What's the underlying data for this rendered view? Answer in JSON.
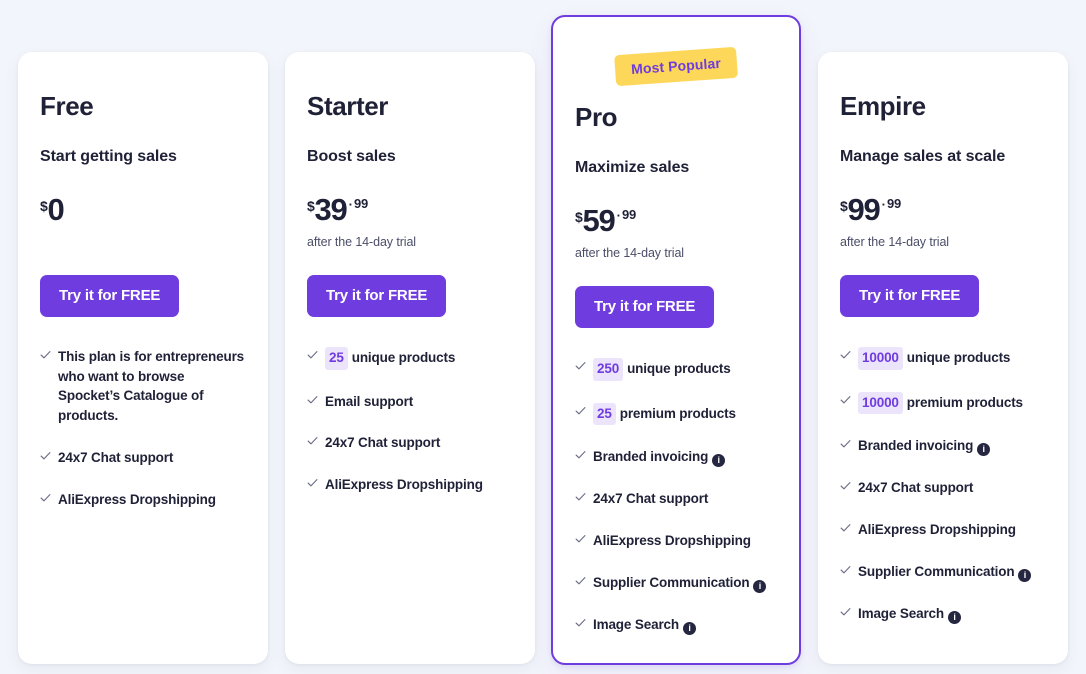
{
  "theme": {
    "page_background": "#f3f5fc",
    "accent_purple": "#6f3ce0",
    "badge_yellow": "#fcd75a",
    "count_badge_bg": "#ece4fb",
    "info_icon_bg": "#252741",
    "text_dark": "#1f2137"
  },
  "plans": [
    {
      "name": "Free",
      "tagline": "Start getting sales",
      "price": {
        "currency": "$",
        "whole": "0",
        "separator": "",
        "cents": ""
      },
      "trial_note": "",
      "cta_label": "Try it for FREE",
      "popular_badge": "",
      "features": [
        {
          "badge": "",
          "text": "This plan is for entrepreneurs who want to browse Spocket’s Catalogue of products.",
          "info": false
        },
        {
          "badge": "",
          "text": "24x7 Chat support",
          "info": false
        },
        {
          "badge": "",
          "text": "AliExpress Dropshipping",
          "info": false
        }
      ]
    },
    {
      "name": "Starter",
      "tagline": "Boost sales",
      "price": {
        "currency": "$",
        "whole": "39",
        "separator": "·",
        "cents": "99"
      },
      "trial_note": "after the 14-day trial",
      "cta_label": "Try it for FREE",
      "popular_badge": "",
      "features": [
        {
          "badge": "25",
          "text": "unique products",
          "info": false
        },
        {
          "badge": "",
          "text": "Email support",
          "info": false
        },
        {
          "badge": "",
          "text": "24x7 Chat support",
          "info": false
        },
        {
          "badge": "",
          "text": "AliExpress Dropshipping",
          "info": false
        }
      ]
    },
    {
      "name": "Pro",
      "tagline": "Maximize sales",
      "price": {
        "currency": "$",
        "whole": "59",
        "separator": "·",
        "cents": "99"
      },
      "trial_note": "after the 14-day trial",
      "cta_label": "Try it for FREE",
      "popular_badge": "Most Popular",
      "features": [
        {
          "badge": "250",
          "text": "unique products",
          "info": false
        },
        {
          "badge": "25",
          "text": "premium products",
          "info": false
        },
        {
          "badge": "",
          "text": "Branded invoicing",
          "info": true
        },
        {
          "badge": "",
          "text": "24x7 Chat support",
          "info": false
        },
        {
          "badge": "",
          "text": "AliExpress Dropshipping",
          "info": false
        },
        {
          "badge": "",
          "text": "Supplier Communication",
          "info": true
        },
        {
          "badge": "",
          "text": "Image Search",
          "info": true
        }
      ]
    },
    {
      "name": "Empire",
      "tagline": "Manage sales at scale",
      "price": {
        "currency": "$",
        "whole": "99",
        "separator": "·",
        "cents": "99"
      },
      "trial_note": "after the 14-day trial",
      "cta_label": "Try it for FREE",
      "popular_badge": "",
      "features": [
        {
          "badge": "10000",
          "text": "unique products",
          "info": false
        },
        {
          "badge": "10000",
          "text": "premium products",
          "info": false
        },
        {
          "badge": "",
          "text": "Branded invoicing",
          "info": true
        },
        {
          "badge": "",
          "text": "24x7 Chat support",
          "info": false
        },
        {
          "badge": "",
          "text": "AliExpress Dropshipping",
          "info": false
        },
        {
          "badge": "",
          "text": "Supplier Communication",
          "info": true
        },
        {
          "badge": "",
          "text": "Image Search",
          "info": true
        }
      ]
    }
  ],
  "icons": {
    "check": "check-icon",
    "info": "info-icon",
    "info_glyph": "i"
  }
}
